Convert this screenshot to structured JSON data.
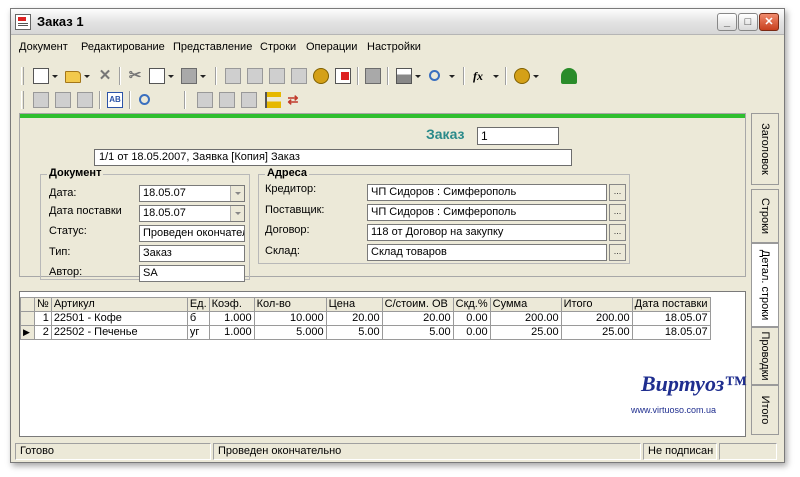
{
  "window": {
    "title": "Заказ 1"
  },
  "menu": [
    "Документ",
    "Редактирование",
    "Представление",
    "Строки",
    "Операции",
    "Настройки"
  ],
  "header": {
    "label": "Заказ",
    "number": "1",
    "description": "1/1 от 18.05.2007, Заявка [Копия] Заказ"
  },
  "document": {
    "title": "Документ",
    "date_label": "Дата:",
    "date_value": "18.05.07",
    "delivery_label": "Дата поставки",
    "delivery_value": "18.05.07",
    "status_label": "Статус:",
    "status_value": "Проведен окончател",
    "type_label": "Тип:",
    "type_value": "Заказ",
    "author_label": "Автор:",
    "author_value": "SA"
  },
  "addresses": {
    "title": "Адреса",
    "creditor_label": "Кредитор:",
    "creditor_value": "ЧП Сидоров : Симферополь",
    "supplier_label": "Поставщик:",
    "supplier_value": "ЧП Сидоров : Симферополь",
    "contract_label": "Договор:",
    "contract_value": "118 от  Договор на закупку",
    "warehouse_label": "Склад:",
    "warehouse_value": "Склад товаров"
  },
  "table": {
    "columns": [
      "№",
      "Артикул",
      "Ед.",
      "Коэф.",
      "Кол-во",
      "Цена",
      "С/стоим. ОВ",
      "Скд.%",
      "Сумма",
      "Итого",
      "Дата поставки"
    ],
    "rows": [
      [
        "1",
        "22501 - Кофе",
        "б",
        "1.000",
        "10.000",
        "20.00",
        "20.00",
        "0.00",
        "200.00",
        "200.00",
        "18.05.07"
      ],
      [
        "2",
        "22502 - Печенье",
        "уг",
        "1.000",
        "5.000",
        "5.00",
        "5.00",
        "0.00",
        "25.00",
        "25.00",
        "18.05.07"
      ]
    ]
  },
  "logo": {
    "name": "Виртуоз™",
    "url": "www.virtuoso.com.ua"
  },
  "tabs": [
    "Заголовок",
    "Строки",
    "Детал. строки",
    "Проводки",
    "Итого"
  ],
  "status": {
    "left": "Готово",
    "middle": "Проведен окончательно",
    "right": "Не подписан"
  }
}
